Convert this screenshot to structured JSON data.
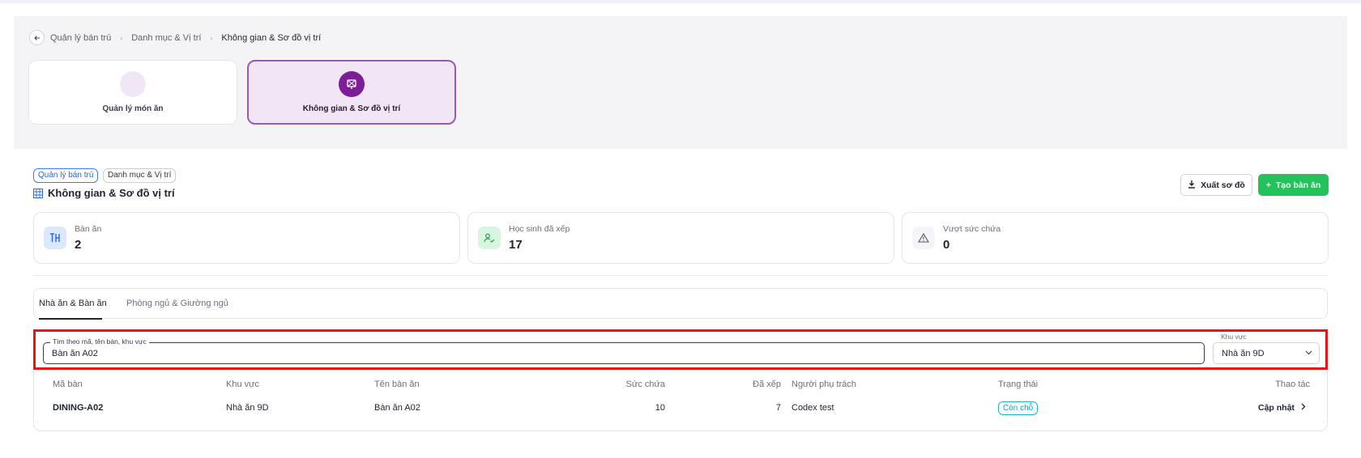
{
  "breadcrumb": {
    "items": [
      "Quản lý bán trú",
      "Danh mục & Vị trí",
      "Không gian & Sơ đồ vị trí"
    ]
  },
  "modules": [
    {
      "label": "Quản lý món ăn",
      "icon": "dish-icon"
    },
    {
      "label": "Không gian & Sơ đồ vị trí",
      "icon": "map-location-icon",
      "active": true
    }
  ],
  "chips": [
    "Quản lý bán trú",
    "Danh mục & Vị trí"
  ],
  "page": {
    "title": "Không gian & Sơ đồ vị trí",
    "title_icon": "grid-icon",
    "export_label": "Xuất sơ đồ",
    "create_label": "Tạo bàn ăn"
  },
  "stats": [
    {
      "label": "Bàn ăn",
      "value": "2",
      "icon": "table-icon"
    },
    {
      "label": "Học sinh đã xếp",
      "value": "17",
      "icon": "student-check-icon"
    },
    {
      "label": "Vượt sức chứa",
      "value": "0",
      "icon": "warning-icon"
    }
  ],
  "tabs": [
    "Nhà ăn & Bàn ăn",
    "Phòng ngủ & Giường ngủ"
  ],
  "filters": {
    "search_label": "Tìm theo mã, tên bàn, khu vực",
    "search_value": "Bàn ăn A02",
    "area_label": "Khu vực",
    "area_value": "Nhà ăn 9D"
  },
  "table": {
    "headers": [
      "Mã bàn",
      "Khu vực",
      "Tên bàn ăn",
      "Sức chứa",
      "Đã xếp",
      "Người phụ trách",
      "Trạng thái",
      "Thao tác"
    ],
    "rows": [
      {
        "code": "DINING-A02",
        "area": "Nhà ăn 9D",
        "name": "Bàn ăn A02",
        "capacity": "10",
        "assigned": "7",
        "manager": "Codex test",
        "status": "Còn chỗ",
        "action": "Cập nhật"
      }
    ]
  },
  "colors": {
    "accent_purple": "#7c1f97",
    "create_green": "#23c25a",
    "highlight_red": "#e8141a",
    "status_teal": "#19b8cc"
  }
}
